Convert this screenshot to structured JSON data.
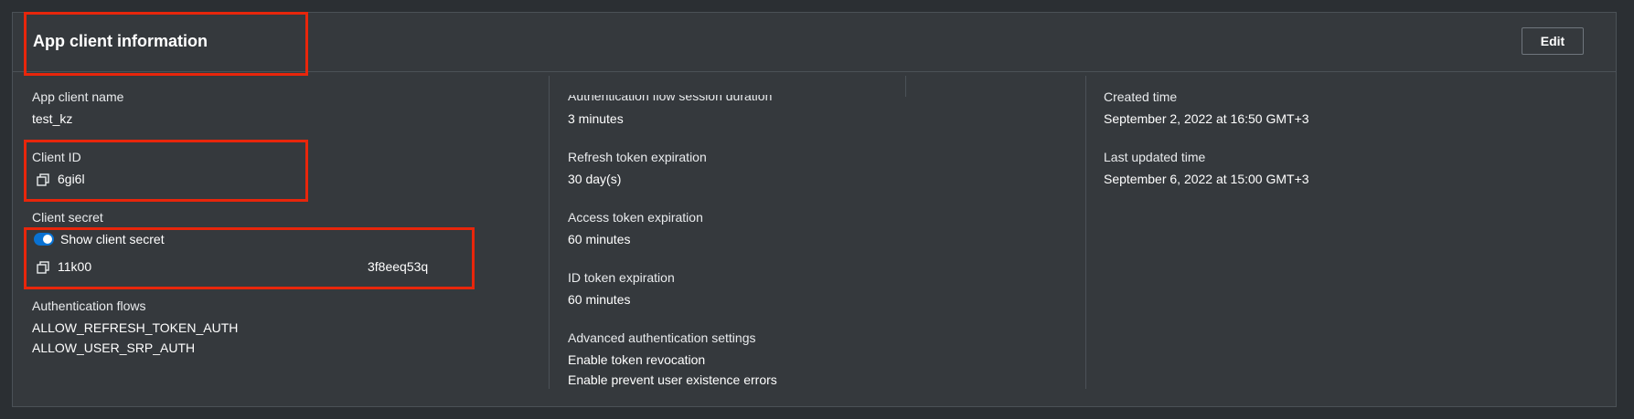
{
  "header": {
    "title": "App client information",
    "edit_label": "Edit"
  },
  "col1": {
    "app_client_name_label": "App client name",
    "app_client_name_value": "test_kz",
    "client_id_label": "Client ID",
    "client_id_value": "6gi6l",
    "client_secret_label": "Client secret",
    "show_secret_label": "Show client secret",
    "show_secret_on": true,
    "client_secret_value_start": "11k00",
    "client_secret_value_end": "3f8eeq53q",
    "auth_flows_label": "Authentication flows",
    "auth_flows": [
      "ALLOW_REFRESH_TOKEN_AUTH",
      "ALLOW_USER_SRP_AUTH"
    ]
  },
  "col2": {
    "session_duration_label": "Authentication flow session duration",
    "session_duration_value": "3 minutes",
    "refresh_label": "Refresh token expiration",
    "refresh_value": "30 day(s)",
    "access_label": "Access token expiration",
    "access_value": "60 minutes",
    "id_label": "ID token expiration",
    "id_value": "60 minutes",
    "advanced_label": "Advanced authentication settings",
    "advanced_items": [
      "Enable token revocation",
      "Enable prevent user existence errors"
    ]
  },
  "col4": {
    "created_label": "Created time",
    "created_value": "September 2, 2022 at 16:50 GMT+3",
    "updated_label": "Last updated time",
    "updated_value": "September 6, 2022 at 15:00 GMT+3"
  },
  "colors": {
    "highlight": "#e8260b",
    "toggle_on": "#0972d3"
  }
}
